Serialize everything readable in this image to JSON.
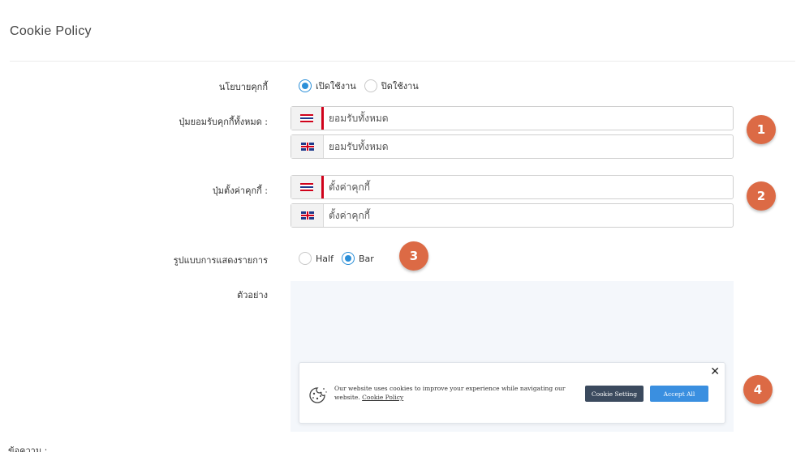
{
  "page": {
    "title": "Cookie  Policy"
  },
  "policy": {
    "label": "นโยบายคุกกี้",
    "options": [
      "เปิดใช้งาน",
      "ปิดใช้งาน"
    ],
    "selected": "เปิดใช้งาน"
  },
  "accept_all": {
    "label": "ปุ่มยอมรับคุกกี้ทั้งหมด :",
    "th_value": "ยอมรับทั้งหมด",
    "en_value": "ยอมรับทั้งหมด"
  },
  "settings_btn": {
    "label": "ปุ่มตั้งค่าคุกกี้ :",
    "th_value": "ตั้งค่าคุกกี้",
    "en_value": "ตั้งค่าคุกกี้"
  },
  "display": {
    "label": "รูปแบบการแสดงรายการ",
    "options": [
      "Half",
      "Bar"
    ],
    "selected": "Bar"
  },
  "preview": {
    "label": "ตัวอย่าง",
    "message": "Our website uses cookies to improve your experience while navigating our website.",
    "link_text": "Cookie Policy",
    "close_symbol": "✕",
    "setting_button": "Cookie Setting",
    "accept_button": "Accept All"
  },
  "badges": [
    "1",
    "2",
    "3",
    "4"
  ],
  "footer": {
    "message_label": "ข้อความ :"
  },
  "colors": {
    "accent": "#2b8fd8",
    "badge": "#dc6a45",
    "flag_active": "#d0021b",
    "setting_btn": "#3b4a5e",
    "accept_btn": "#3a8fe0"
  }
}
